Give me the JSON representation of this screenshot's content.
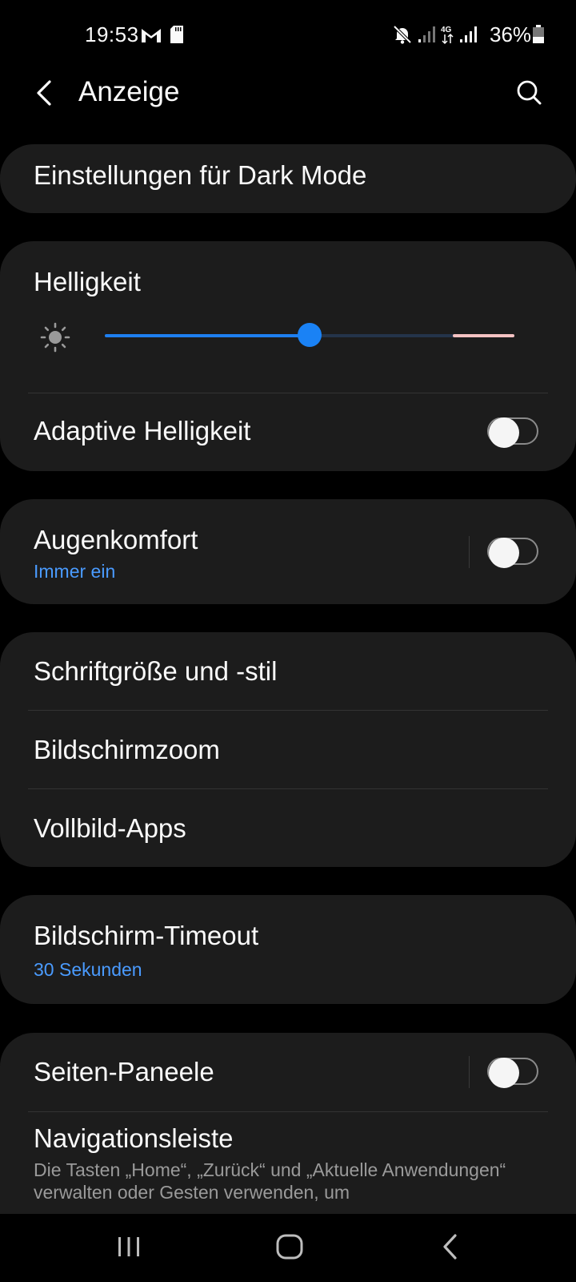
{
  "status_bar": {
    "time": "19:53",
    "battery_text": "36%",
    "icons": [
      "gmail-icon",
      "sd-card-icon",
      "mute-icon",
      "signal-icon",
      "4g-icon",
      "signal-icon",
      "battery-icon"
    ]
  },
  "header": {
    "title": "Anzeige",
    "back_icon": "back-arrow-icon",
    "search_icon": "search-icon"
  },
  "dark_mode": {
    "label": "Einstellungen für Dark Mode"
  },
  "brightness": {
    "label": "Helligkeit",
    "icon": "sun-icon",
    "value_percent": 50,
    "extra_percent": 85,
    "adaptive_label": "Adaptive Helligkeit",
    "adaptive_on": false
  },
  "eye_comfort": {
    "label": "Augenkomfort",
    "sub": "Immer ein",
    "on": false
  },
  "font_group": {
    "font_label": "Schriftgröße und -stil",
    "zoom_label": "Bildschirmzoom",
    "fullscreen_label": "Vollbild-Apps"
  },
  "timeout": {
    "label": "Bildschirm-Timeout",
    "sub": "30 Sekunden"
  },
  "side_panel": {
    "label": "Seiten-Paneele",
    "on": false
  },
  "navbar_setting": {
    "label": "Navigationsleiste",
    "desc": "Die Tasten „Home“, „Zurück“ und „Aktuelle Anwendungen“ verwalten oder Gesten verwenden, um"
  },
  "colors": {
    "background": "#000000",
    "card": "#1c1c1c",
    "accent": "#3e91ff",
    "text": "#fafafa"
  },
  "nav_bar": {
    "icons": [
      "recents-icon",
      "home-icon",
      "back-icon"
    ]
  }
}
